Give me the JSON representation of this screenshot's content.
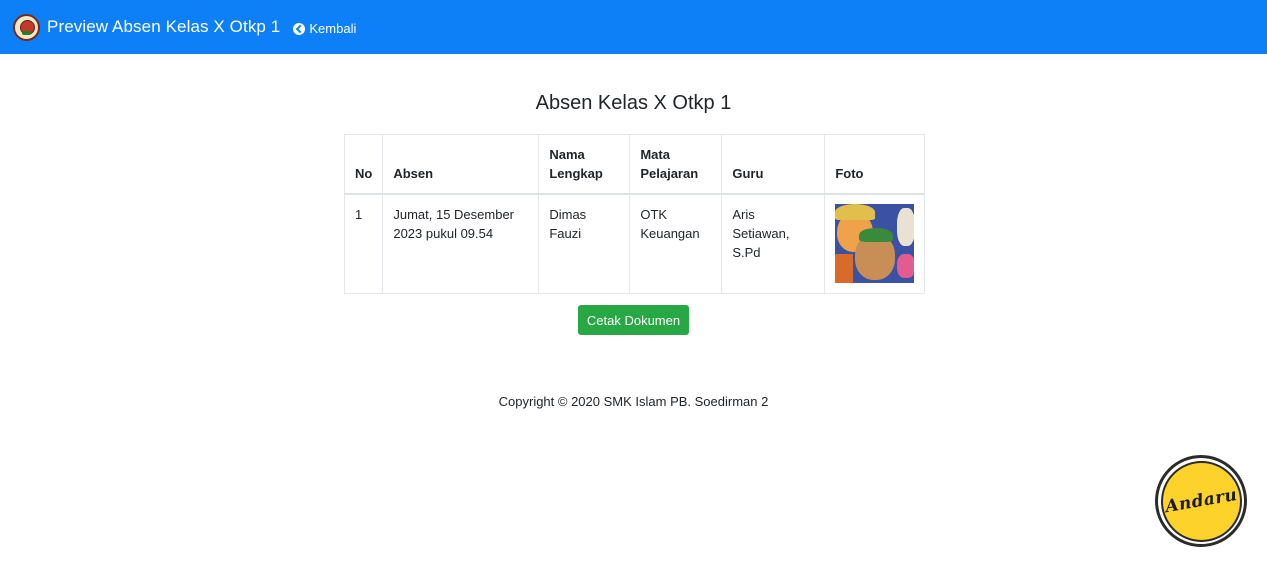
{
  "navbar": {
    "title": "Preview Absen Kelas X Otkp 1",
    "back_label": "Kembali",
    "color": "#0d7ff7"
  },
  "main": {
    "heading": "Absen Kelas X Otkp 1",
    "table": {
      "headers": {
        "no": "No",
        "absen": "Absen",
        "nama_1": "Nama",
        "nama_2": "Lengkap",
        "mapel_1": "Mata",
        "mapel_2": "Pelajaran",
        "guru": "Guru",
        "foto": "Foto"
      },
      "rows": [
        {
          "no": "1",
          "absen_1": "Jumat, 15 Desember",
          "absen_2": "2023 pukul 09.54",
          "nama": "Dimas Fauzi",
          "mapel_1": "OTK",
          "mapel_2": "Keuangan",
          "guru_1": "Aris Setiawan,",
          "guru_2": "S.Pd",
          "foto_icon": "photo-thumbnail"
        }
      ]
    },
    "print_button": "Cetak Dokumen",
    "print_button_color": "#28a745"
  },
  "footer": {
    "copyright": "Copyright © 2020 SMK Islam PB. Soedirman 2"
  },
  "watermark": {
    "label": "Andaru",
    "color": "#fcd22b"
  }
}
